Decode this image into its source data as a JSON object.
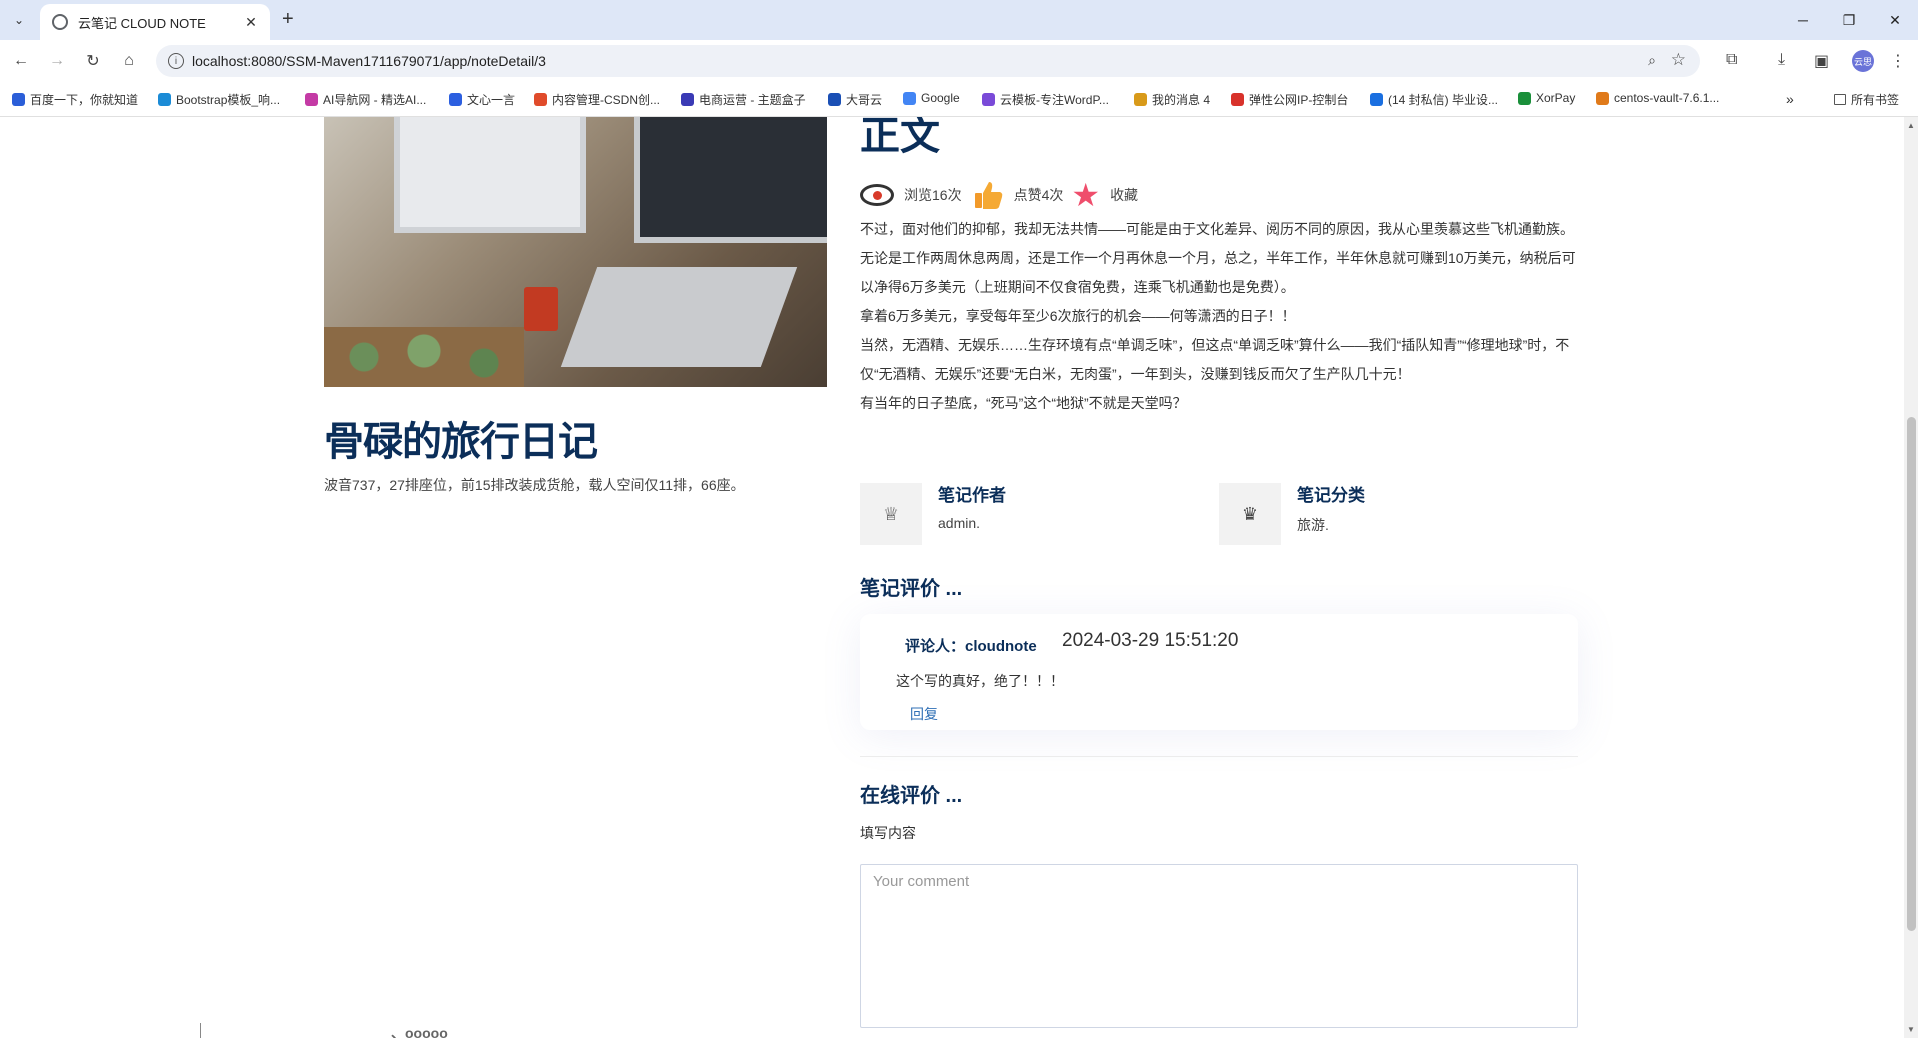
{
  "browser": {
    "tab_title": "云笔记 CLOUD NOTE",
    "new_tab": "+",
    "url": "localhost:8080/SSM-Maven1711679071/app/noteDetail/3",
    "profile_initials": "云思",
    "bookmarks": [
      {
        "label": "百度一下，你就知道",
        "color": "#2b5ed8"
      },
      {
        "label": "Bootstrap模板_响...",
        "color": "#1b8bd6"
      },
      {
        "label": "AI导航网 - 精选AI...",
        "color": "#c43aa5"
      },
      {
        "label": "文心一言",
        "color": "#2c5fe0"
      },
      {
        "label": "内容管理-CSDN创...",
        "color": "#e04b2b"
      },
      {
        "label": "电商运营 - 主题盒子",
        "color": "#3a3ab5"
      },
      {
        "label": "大哥云",
        "color": "#1a4fb5"
      },
      {
        "label": "Google",
        "color": "#4285f4"
      },
      {
        "label": "云模板-专注WordP...",
        "color": "#7a4ad8"
      },
      {
        "label": "我的消息 4",
        "color": "#d89a1a"
      },
      {
        "label": "弹性公网IP-控制台",
        "color": "#d8322b"
      },
      {
        "label": "(14 封私信) 毕业设...",
        "color": "#1a6fe0"
      },
      {
        "label": "XorPay",
        "color": "#1a8f3a"
      },
      {
        "label": "centos-vault-7.6.1...",
        "color": "#e07a1a"
      }
    ],
    "all_bookmarks": "所有书签"
  },
  "note": {
    "left_title": "骨碌的旅行日记",
    "left_desc": "波音737，27排座位，前15排改装成货舱，载人空间仅11排，66座。",
    "section_title": "正文",
    "views": "浏览16次",
    "likes": "点赞4次",
    "favorite": "收藏",
    "paragraphs": [
      "不过，面对他们的抑郁，我却无法共情——可能是由于文化差异、阅历不同的原因，我从心里羡慕这些飞机通勤族。",
      "无论是工作两周休息两周，还是工作一个月再休息一个月，总之，半年工作，半年休息就可赚到10万美元，纳税后可以净得6万多美元（上班期间不仅食宿免费，连乘飞机通勤也是免费）。",
      "拿着6万多美元，享受每年至少6次旅行的机会——何等潇洒的日子！！",
      "当然，无酒精、无娱乐……生存环境有点“单调乏味”，但这点“单调乏味”算什么——我们“插队知青”“修理地球”时，不仅“无酒精、无娱乐”还要“无白米，无肉蛋”，一年到头，没赚到钱反而欠了生产队几十元！",
      "有当年的日子垫底，“死马”这个“地狱”不就是天堂吗？"
    ],
    "author_label": "笔记作者",
    "author_value": "admin.",
    "category_label": "笔记分类",
    "category_value": "旅游."
  },
  "reviews": {
    "title": "笔记评价 ...",
    "items": [
      {
        "reviewer": "评论人：cloudnote",
        "time": "2024-03-29 15:51:20",
        "text": "这个写的真好，绝了！！！",
        "reply": "回复"
      }
    ]
  },
  "online_review": {
    "title": "在线评价 ...",
    "fill_label": "填写内容",
    "placeholder": "Your comment"
  },
  "footer_peek": "、ooooo"
}
